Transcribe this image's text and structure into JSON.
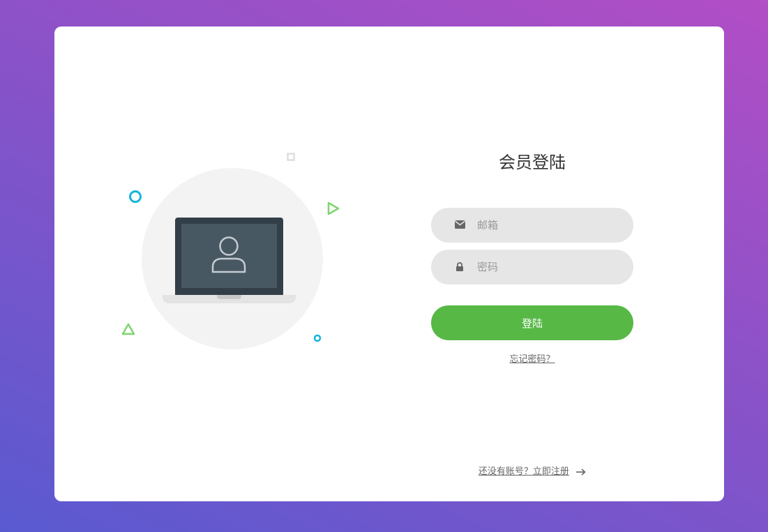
{
  "colors": {
    "accent": "#57b846",
    "field_bg": "#e6e6e6",
    "teal": "#14b4dc",
    "green_outline": "#7ed56f"
  },
  "illustration": {
    "icons": [
      "laptop-icon",
      "user-icon",
      "circle-icon",
      "square-icon",
      "triangle-icon"
    ]
  },
  "login": {
    "title": "会员登陆",
    "email": {
      "placeholder": "邮箱",
      "value": "",
      "icon": "envelope-icon"
    },
    "password": {
      "placeholder": "密码",
      "value": "",
      "icon": "lock-icon"
    },
    "submit_label": "登陆",
    "forgot_label": "忘记密码？",
    "register_label": "还没有账号？立即注册",
    "register_icon": "arrow-right-icon"
  }
}
